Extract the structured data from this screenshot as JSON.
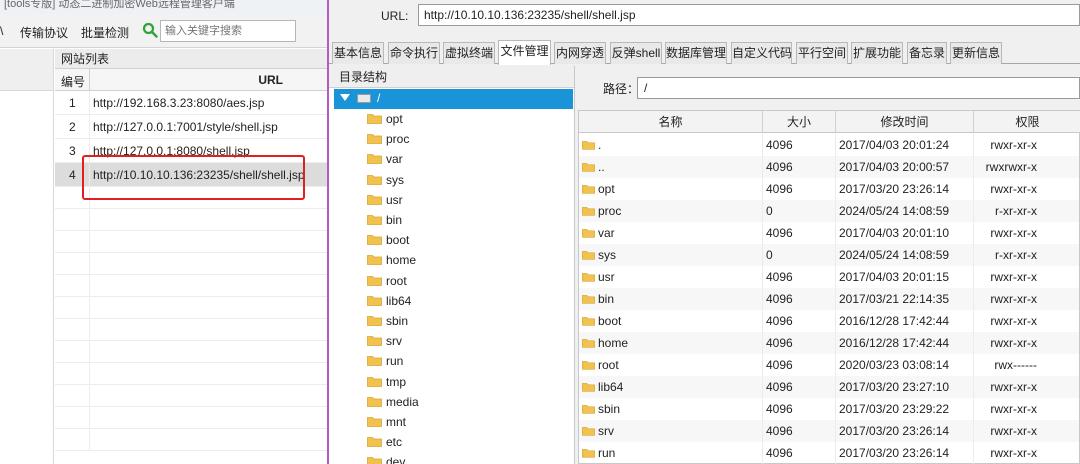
{
  "left_window": {
    "title_fragment": "[tools专版] 动态二进制加密Web远程管理客户端",
    "toolbar": {
      "partial_item": "\\",
      "protocol_label": "传输协议",
      "batch_label": "批量检测",
      "search_placeholder": "输入关键字搜索"
    },
    "site_list": {
      "title": "网站列表",
      "col_no": "编号",
      "col_url": "URL",
      "rows": [
        {
          "no": "1",
          "url": "http://192.168.3.23:8080/aes.jsp"
        },
        {
          "no": "2",
          "url": "http://127.0.0.1:7001/style/shell.jsp"
        },
        {
          "no": "3",
          "url": "http://127.0.0.1:8080/shell.jsp"
        },
        {
          "no": "4",
          "url": "http://10.10.10.136:23235/shell/shell.jsp"
        }
      ]
    }
  },
  "right_window": {
    "url_label": "URL:",
    "url_value": "http://10.10.10.136:23235/shell/shell.jsp",
    "tabs": [
      "基本信息",
      "命令执行",
      "虚拟终端",
      "文件管理",
      "内网穿透",
      "反弹shell",
      "数据库管理",
      "自定义代码",
      "平行空间",
      "扩展功能",
      "备忘录",
      "更新信息"
    ],
    "active_tab": "文件管理",
    "tree": {
      "title": "目录结构",
      "root": "/",
      "nodes": [
        "opt",
        "proc",
        "var",
        "sys",
        "usr",
        "bin",
        "boot",
        "home",
        "root",
        "lib64",
        "sbin",
        "srv",
        "run",
        "tmp",
        "media",
        "mnt",
        "etc",
        "dev"
      ]
    },
    "path_label": "路径：",
    "path_value": "/",
    "files": {
      "headers": {
        "name": "名称",
        "size": "大小",
        "mtime": "修改时间",
        "perm": "权限"
      },
      "rows": [
        {
          "name": ".",
          "size": "4096",
          "mtime": "2017/04/03 20:01:24",
          "perm": "rwxr-xr-x"
        },
        {
          "name": "..",
          "size": "4096",
          "mtime": "2017/04/03 20:00:57",
          "perm": "rwxrwxr-x"
        },
        {
          "name": "opt",
          "size": "4096",
          "mtime": "2017/03/20 23:26:14",
          "perm": "rwxr-xr-x"
        },
        {
          "name": "proc",
          "size": "0",
          "mtime": "2024/05/24 14:08:59",
          "perm": "r-xr-xr-x"
        },
        {
          "name": "var",
          "size": "4096",
          "mtime": "2017/04/03 20:01:10",
          "perm": "rwxr-xr-x"
        },
        {
          "name": "sys",
          "size": "0",
          "mtime": "2024/05/24 14:08:59",
          "perm": "r-xr-xr-x"
        },
        {
          "name": "usr",
          "size": "4096",
          "mtime": "2017/04/03 20:01:15",
          "perm": "rwxr-xr-x"
        },
        {
          "name": "bin",
          "size": "4096",
          "mtime": "2017/03/21 22:14:35",
          "perm": "rwxr-xr-x"
        },
        {
          "name": "boot",
          "size": "4096",
          "mtime": "2016/12/28 17:42:44",
          "perm": "rwxr-xr-x"
        },
        {
          "name": "home",
          "size": "4096",
          "mtime": "2016/12/28 17:42:44",
          "perm": "rwxr-xr-x"
        },
        {
          "name": "root",
          "size": "4096",
          "mtime": "2020/03/23 03:08:14",
          "perm": "rwx------"
        },
        {
          "name": "lib64",
          "size": "4096",
          "mtime": "2017/03/20 23:27:10",
          "perm": "rwxr-xr-x"
        },
        {
          "name": "sbin",
          "size": "4096",
          "mtime": "2017/03/20 23:29:22",
          "perm": "rwxr-xr-x"
        },
        {
          "name": "srv",
          "size": "4096",
          "mtime": "2017/03/20 23:26:14",
          "perm": "rwxr-xr-x"
        },
        {
          "name": "run",
          "size": "4096",
          "mtime": "2017/03/20 23:26:14",
          "perm": "rwxr-xr-x"
        }
      ]
    }
  },
  "colors": {
    "highlight_box": "#e02020",
    "tree_selected": "#1a94d8",
    "folder": "#f2c24e",
    "divider": "#b05cc0"
  }
}
